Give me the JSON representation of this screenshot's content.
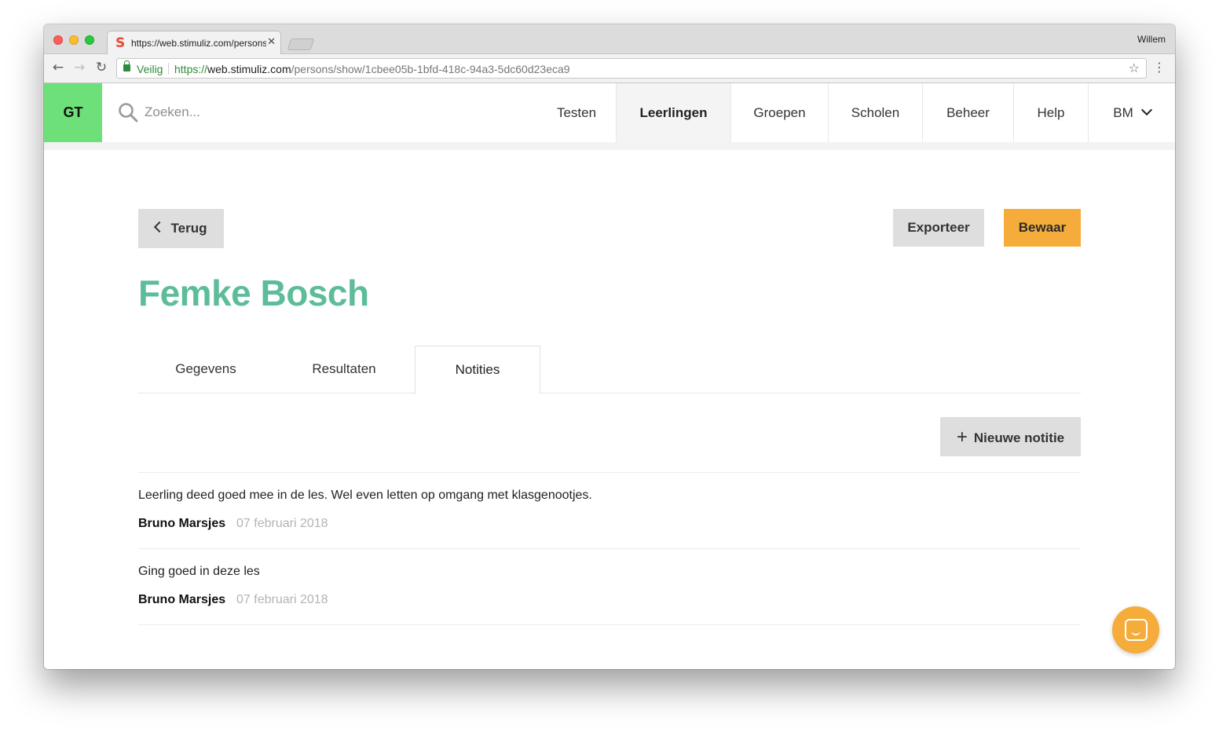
{
  "browser": {
    "tab_title": "https://web.stimuliz.com/persons/show",
    "favicon": "S",
    "profile_name": "Willem",
    "secure_label": "Veilig",
    "url_scheme": "https://",
    "url_host": "web.stimuliz.com",
    "url_path": "/persons/show/1cbee05b-1bfd-418c-94a3-5dc60d23eca9"
  },
  "appbar": {
    "logo": "GT",
    "search_placeholder": "Zoeken...",
    "nav": [
      "Testen",
      "Leerlingen",
      "Groepen",
      "Scholen",
      "Beheer",
      "Help"
    ],
    "active_nav": "Leerlingen",
    "user_initials": "BM"
  },
  "page": {
    "back_label": "Terug",
    "export_label": "Exporteer",
    "save_label": "Bewaar",
    "title": "Femke Bosch",
    "tabs": [
      "Gegevens",
      "Resultaten",
      "Notities"
    ],
    "active_tab": "Notities",
    "new_note_label": "Nieuwe notitie",
    "notes": [
      {
        "text": "Leerling deed goed mee in de les. Wel even letten op omgang met klasgenootjes.",
        "author": "Bruno Marsjes",
        "date": "07 februari 2018"
      },
      {
        "text": "Ging goed in deze les",
        "author": "Bruno Marsjes",
        "date": "07 februari 2018"
      }
    ]
  },
  "colors": {
    "brand_green": "#6ee07a",
    "title_green": "#5dbd9a",
    "accent_orange": "#f5ac3a"
  }
}
